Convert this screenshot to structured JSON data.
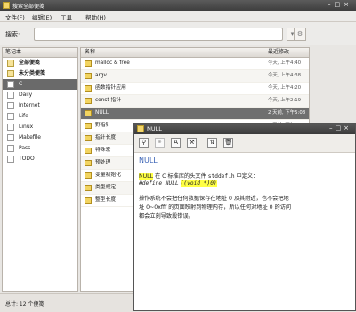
{
  "window": {
    "title": "搜索全部便笺"
  },
  "menu": [
    "文件(F)",
    "编辑(E)",
    "工具",
    "帮助(H)"
  ],
  "search": {
    "label": "搜索:",
    "value": "",
    "placeholder": ""
  },
  "notebooks": {
    "header": "笔记本",
    "items": [
      {
        "label": "全部便笺",
        "icon": "stack-icon",
        "bold": true
      },
      {
        "label": "未分类便笺",
        "icon": "stack-icon",
        "bold": true
      },
      {
        "label": "C",
        "icon": "notebook-icon",
        "selected": true
      },
      {
        "label": "Daily",
        "icon": "notebook-icon"
      },
      {
        "label": "Internet",
        "icon": "notebook-icon"
      },
      {
        "label": "Life",
        "icon": "notebook-icon"
      },
      {
        "label": "Linux",
        "icon": "notebook-icon"
      },
      {
        "label": "Makefile",
        "icon": "notebook-icon"
      },
      {
        "label": "Pass",
        "icon": "notebook-icon"
      },
      {
        "label": "TODO",
        "icon": "notebook-icon"
      }
    ]
  },
  "notes": {
    "header_name": "名称",
    "header_date": "最近修改",
    "rows": [
      {
        "title": "malloc & free",
        "date": "今天, 上午4:40"
      },
      {
        "title": "argv",
        "date": "今天, 上午4:38"
      },
      {
        "title": "函数指针应用",
        "date": "今天, 上午4:20"
      },
      {
        "title": "const 指针",
        "date": "今天, 上午2:19"
      },
      {
        "title": "NULL",
        "date": "2 天前, 下午5:08",
        "selected": true
      },
      {
        "title": "野指针",
        "date": "2 天前, 下午5:08"
      },
      {
        "title": "指针长度",
        "date": ""
      },
      {
        "title": "特殊宏",
        "date": ""
      },
      {
        "title": "预处理",
        "date": ""
      },
      {
        "title": "变量初始化",
        "date": ""
      },
      {
        "title": "类型规定",
        "date": ""
      },
      {
        "title": "整型长度",
        "date": ""
      }
    ]
  },
  "status": {
    "text": "总计: 12 个便笺"
  },
  "note_window": {
    "title": "NULL",
    "note_title": "NULL",
    "line1_pre": "在 C 标准库的头文件",
    "line1_code": "stddef.h",
    "line1_post": "中定义：",
    "define_code": "#define NULL",
    "define_macro": "((void *)0)",
    "para1": "操作系统不会把任何数据保存在地址 0 及其附近，也不会把地",
    "para2": "址 0~0xfff 的页面映射到物理内存，所以任何对地址 0 的访问",
    "para3": "都会立刻导致段错误。"
  }
}
